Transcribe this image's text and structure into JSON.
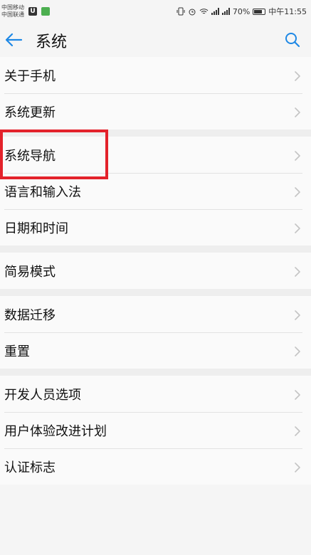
{
  "status_bar": {
    "carrier1": "中国移动",
    "carrier2": "中国联通",
    "battery": "70%",
    "time": "中午11:55"
  },
  "header": {
    "title": "系统"
  },
  "groups": [
    [
      "关于手机",
      "系统更新"
    ],
    [
      "系统导航",
      "语言和输入法",
      "日期和时间"
    ],
    [
      "简易模式"
    ],
    [
      "数据迁移",
      "重置"
    ],
    [
      "开发人员选项",
      "用户体验改进计划",
      "认证标志"
    ]
  ],
  "colors": {
    "accent": "#1e88e5",
    "highlight_box": "#e3222b"
  }
}
